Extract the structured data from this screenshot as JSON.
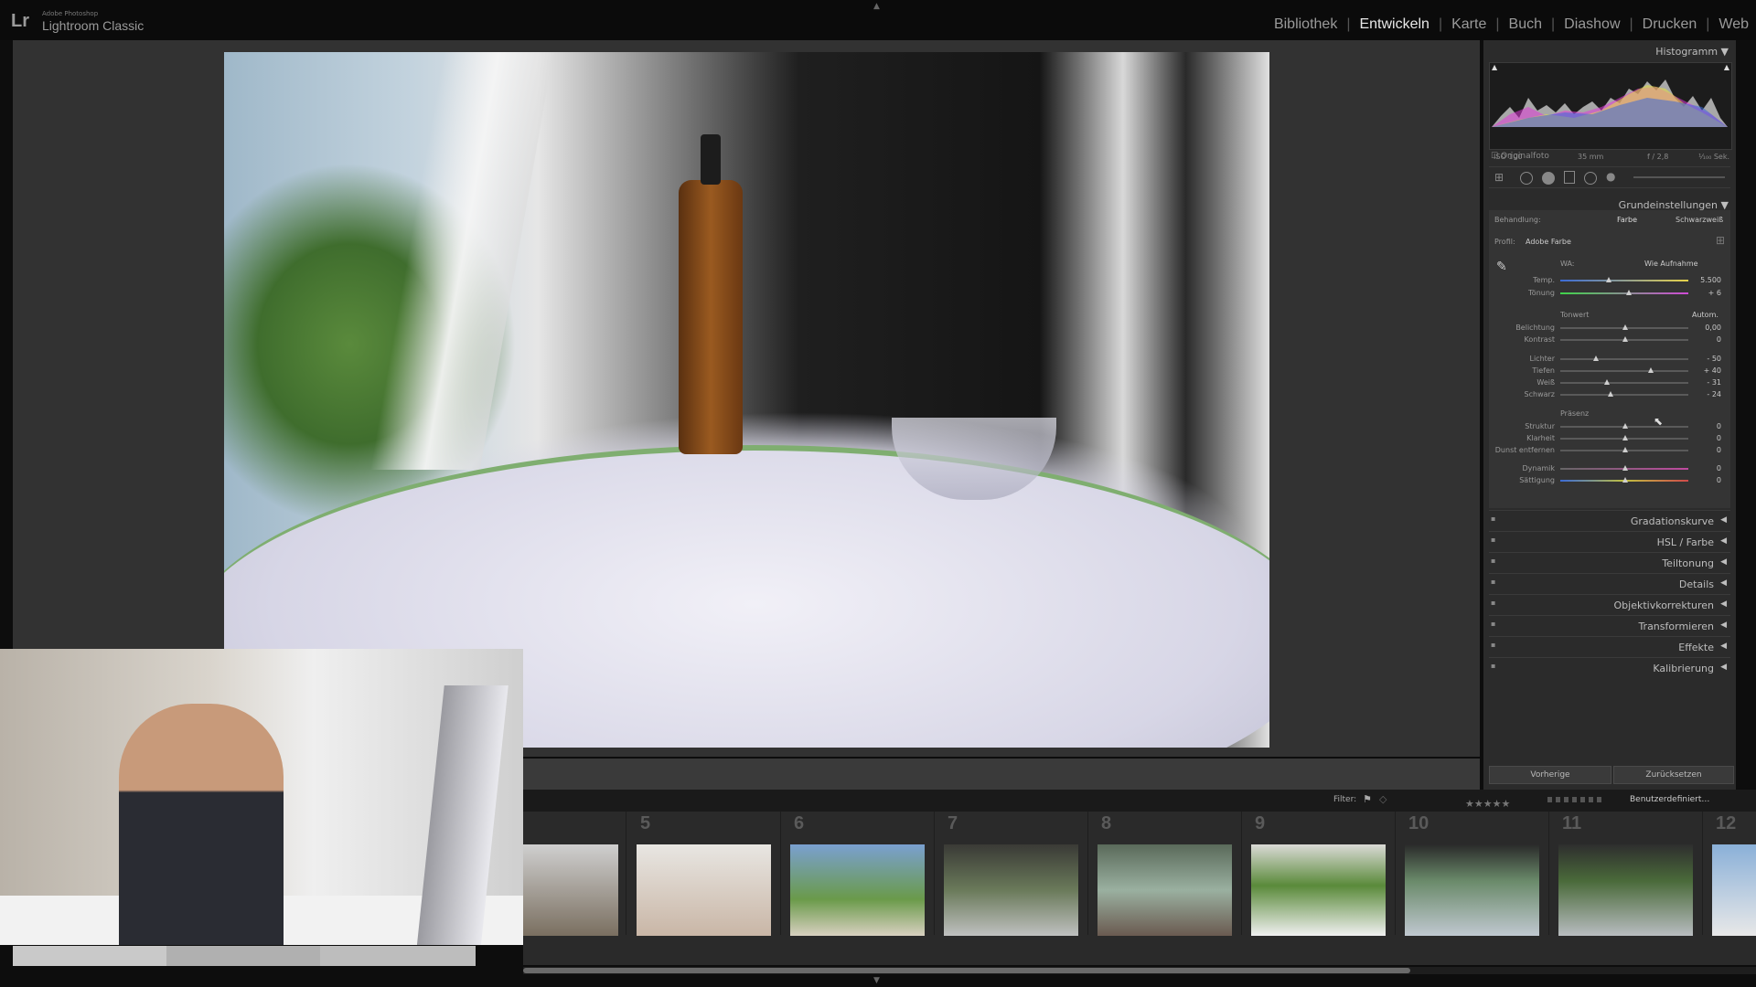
{
  "app": {
    "logo": "Lr",
    "brand_small": "Adobe Photoshop",
    "brand_main": "Lightroom Classic"
  },
  "modules": [
    {
      "label": "Bibliothek",
      "active": false
    },
    {
      "label": "Entwickeln",
      "active": true
    },
    {
      "label": "Karte",
      "active": false
    },
    {
      "label": "Buch",
      "active": false
    },
    {
      "label": "Diashow",
      "active": false
    },
    {
      "label": "Drucken",
      "active": false
    },
    {
      "label": "Web",
      "active": false
    }
  ],
  "right_panel": {
    "histogram": {
      "title": "Histogramm",
      "iso": "ISO 100",
      "focal": "35 mm",
      "aperture": "f / 2,8",
      "shutter": "⅟₁₀₀ Sek.",
      "original_label": "Originalfoto"
    },
    "basic": {
      "title": "Grundeinstellungen",
      "treatment_label": "Behandlung:",
      "treatment_color": "Farbe",
      "treatment_bw": "Schwarzweiß",
      "profile_label": "Profil:",
      "profile_value": "Adobe Farbe",
      "wb_label": "WA:",
      "wb_value": "Wie Aufnahme",
      "temp_label": "Temp.",
      "temp_value": "5.500",
      "tint_label": "Tönung",
      "tint_value": "+ 6",
      "tone_label": "Tonwert",
      "auto_label": "Autom.",
      "exposure_label": "Belichtung",
      "exposure_value": "0,00",
      "contrast_label": "Kontrast",
      "contrast_value": "0",
      "highlights_label": "Lichter",
      "highlights_value": "- 50",
      "shadows_label": "Tiefen",
      "shadows_value": "+ 40",
      "whites_label": "Weiß",
      "whites_value": "- 31",
      "blacks_label": "Schwarz",
      "blacks_value": "- 24",
      "presence_label": "Präsenz",
      "texture_label": "Struktur",
      "texture_value": "0",
      "clarity_label": "Klarheit",
      "clarity_value": "0",
      "dehaze_label": "Dunst entfernen",
      "dehaze_value": "0",
      "vibrance_label": "Dynamik",
      "vibrance_value": "0",
      "saturation_label": "Sättigung",
      "saturation_value": "0"
    },
    "sections": [
      "Gradationskurve",
      "HSL / Farbe",
      "Teiltonung",
      "Details",
      "Objektivkorrekturen",
      "Transformieren",
      "Effekte",
      "Kalibrierung"
    ],
    "buttons": {
      "previous": "Vorherige",
      "reset": "Zurücksetzen"
    }
  },
  "filmstrip": {
    "filter_label": "Filter:",
    "preset": "Benutzerdefiniert…",
    "frames": [
      {
        "num": "",
        "thumb_color": "#8a8a80"
      },
      {
        "num": "5",
        "thumb_color": "#d8d4cc"
      },
      {
        "num": "6",
        "thumb_color": "#7a9a5a"
      },
      {
        "num": "7",
        "thumb_color": "#5a6a4a"
      },
      {
        "num": "8",
        "thumb_color": "#7a8a7a"
      },
      {
        "num": "9",
        "thumb_color": "#e0e0dc"
      },
      {
        "num": "10",
        "thumb_color": "#6a7a8a"
      },
      {
        "num": "11",
        "thumb_color": "#5a6a5a"
      },
      {
        "num": "12",
        "thumb_color": "#aab0b8"
      }
    ]
  }
}
